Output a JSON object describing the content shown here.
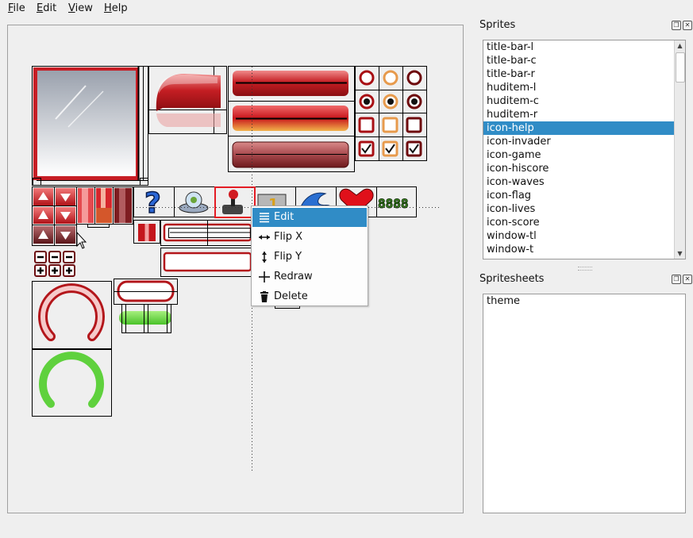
{
  "menubar": {
    "file": "File",
    "file_key": "F",
    "file_rest": "ile",
    "edit": "Edit",
    "edit_key": "E",
    "edit_rest": "dit",
    "view": "View",
    "view_key": "V",
    "view_rest": "iew",
    "help": "Help",
    "help_key": "H",
    "help_rest": "elp"
  },
  "sprites_panel": {
    "title": "Sprites",
    "items": [
      "title-bar-l",
      "title-bar-c",
      "title-bar-r",
      "huditem-l",
      "huditem-c",
      "huditem-r",
      "icon-help",
      "icon-invader",
      "icon-game",
      "icon-hiscore",
      "icon-waves",
      "icon-flag",
      "icon-lives",
      "icon-score",
      "window-tl",
      "window-t"
    ],
    "selected_index": 6
  },
  "spritesheets_panel": {
    "title": "Spritesheets",
    "items": [
      "theme"
    ]
  },
  "context_menu": {
    "items": [
      {
        "label": "Edit",
        "icon": "list-icon",
        "highlighted": true
      },
      {
        "label": "Flip X",
        "icon": "flip-horizontal-icon",
        "highlighted": false
      },
      {
        "label": "Flip Y",
        "icon": "flip-vertical-icon",
        "highlighted": false
      },
      {
        "label": "Redraw",
        "icon": "plus-icon",
        "highlighted": false
      },
      {
        "label": "Delete",
        "icon": "trash-icon",
        "highlighted": false
      }
    ]
  },
  "canvas": {
    "score_digits": "8888"
  },
  "colors": {
    "selection": "#308cc6",
    "sprite_red": "#b3161b",
    "sprite_green": "#5fd13d"
  }
}
